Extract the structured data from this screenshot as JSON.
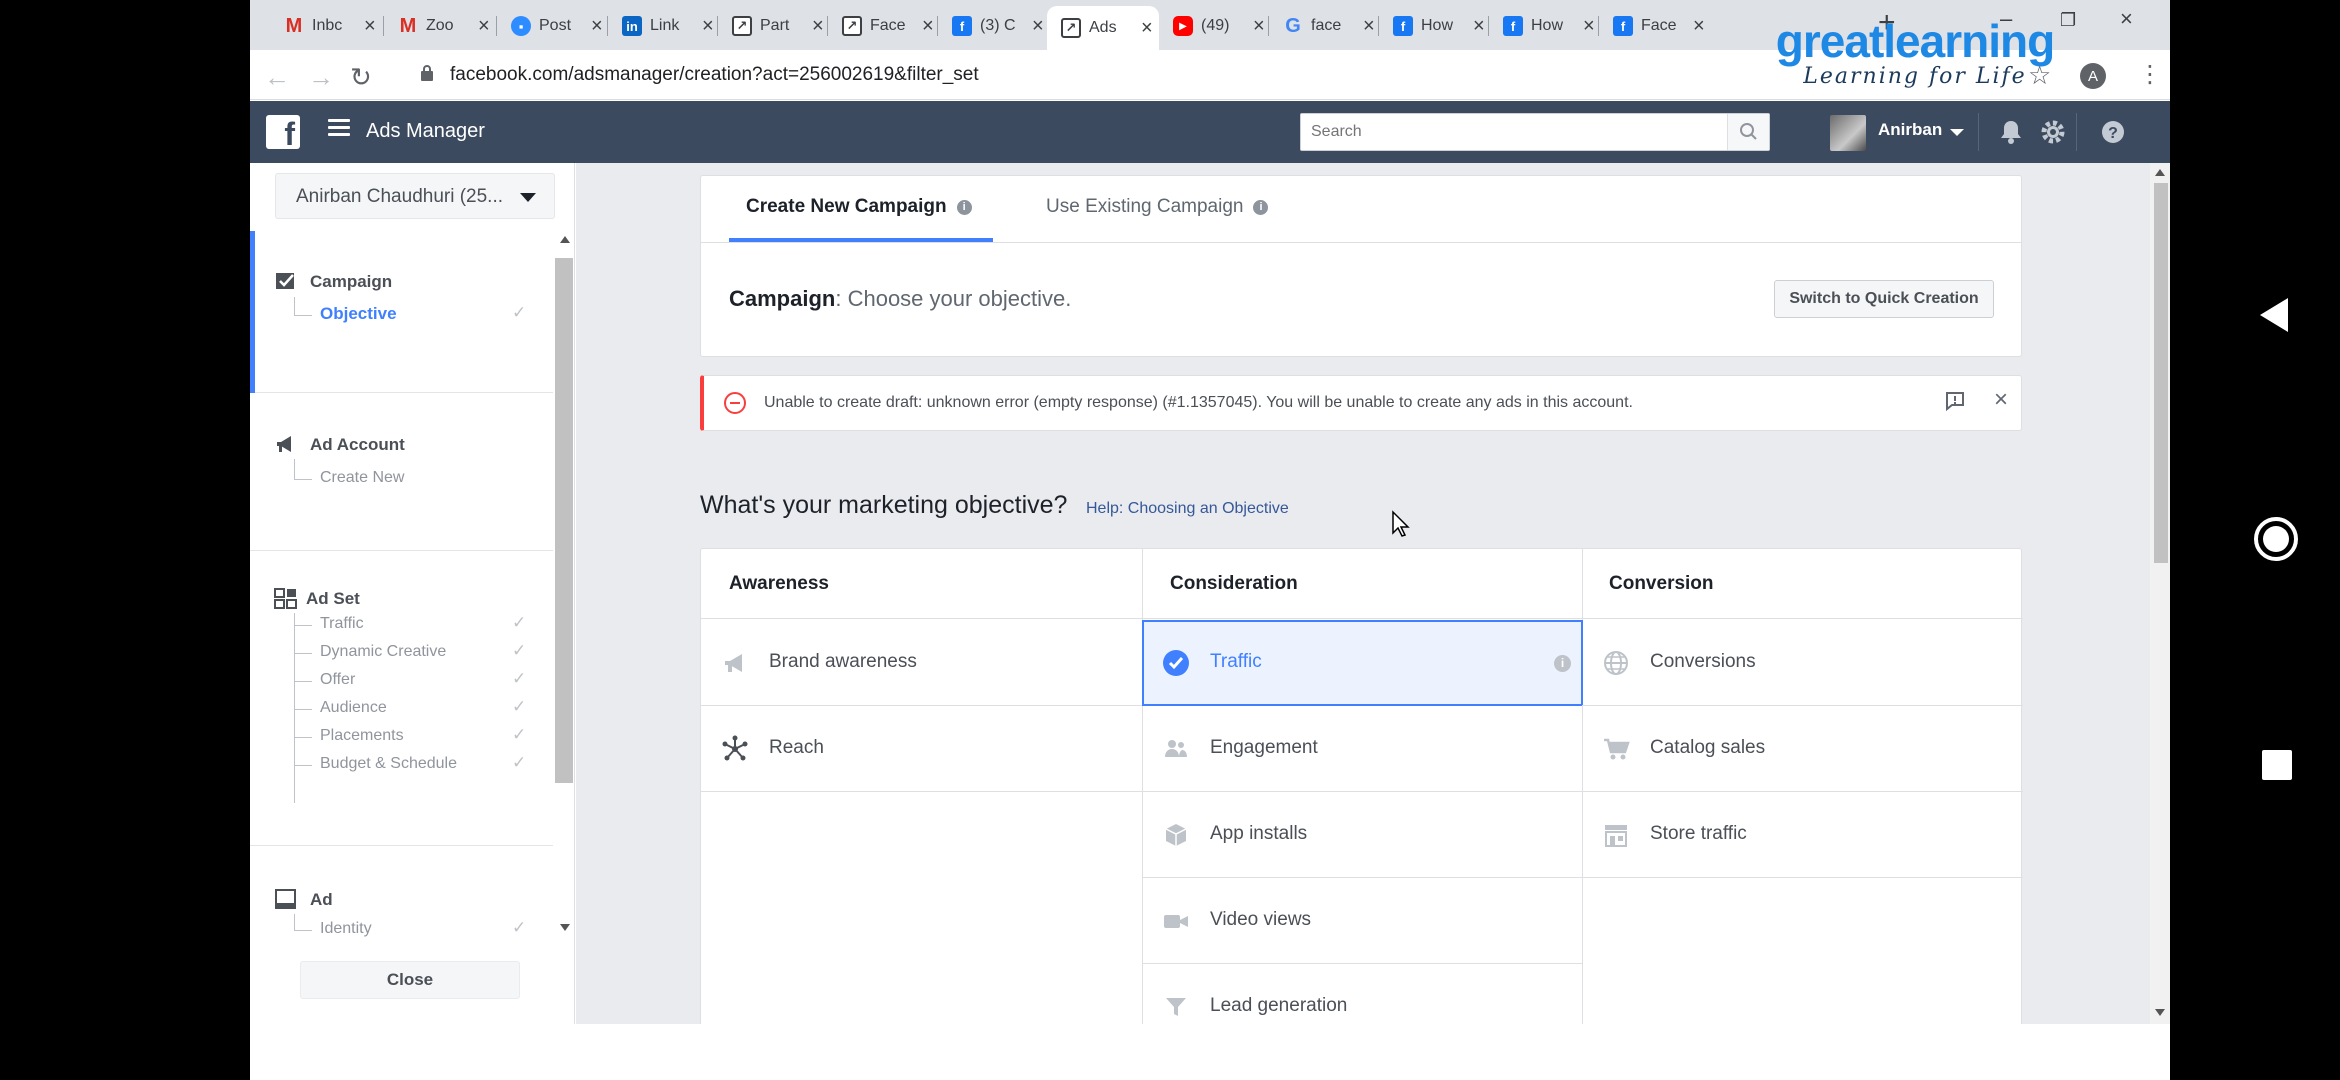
{
  "browser": {
    "tabs": [
      {
        "label": "Inbc",
        "icon": "gmail-icon"
      },
      {
        "label": "Zoo",
        "icon": "gmail-icon"
      },
      {
        "label": "Post",
        "icon": "zoom-icon"
      },
      {
        "label": "Link",
        "icon": "linkedin-icon"
      },
      {
        "label": "Part",
        "icon": "ads-manager-icon"
      },
      {
        "label": "Face",
        "icon": "ads-manager-icon"
      },
      {
        "label": "(3) C",
        "icon": "facebook-icon"
      },
      {
        "label": "Ads",
        "icon": "ads-manager-icon",
        "active": true
      },
      {
        "label": "(49)",
        "icon": "youtube-icon"
      },
      {
        "label": "face",
        "icon": "google-icon"
      },
      {
        "label": "How",
        "icon": "facebook-icon"
      },
      {
        "label": "How",
        "icon": "facebook-icon"
      },
      {
        "label": "Face",
        "icon": "facebook-icon"
      }
    ],
    "new_tab": "+",
    "close_glyph": "×",
    "url": "facebook.com/adsmanager/creation?act=256002619&filter_set",
    "profile_initial": "A"
  },
  "watermark": {
    "logo": "greatlearning",
    "tagline": "Learning for Life"
  },
  "header": {
    "app_title": "Ads Manager",
    "search_placeholder": "Search",
    "user_name": "Anirban"
  },
  "sidebar": {
    "account": "Anirban Chaudhuri (25...",
    "sections": {
      "campaign": {
        "title": "Campaign",
        "items": [
          "Objective"
        ]
      },
      "ad_account": {
        "title": "Ad Account",
        "items": [
          "Create New"
        ]
      },
      "ad_set": {
        "title": "Ad Set",
        "items": [
          "Traffic",
          "Dynamic Creative",
          "Offer",
          "Audience",
          "Placements",
          "Budget & Schedule"
        ]
      },
      "ad": {
        "title": "Ad",
        "items": [
          "Identity"
        ]
      }
    },
    "check": "✓",
    "close_label": "Close"
  },
  "main": {
    "tabs": {
      "create": "Create New Campaign",
      "existing": "Use Existing Campaign"
    },
    "info_glyph": "i",
    "campaign_label": "Campaign",
    "campaign_text": ": Choose your objective.",
    "quick_creation": "Switch to Quick Creation",
    "error_text": "Unable to create draft: unknown error (empty response) (#1.1357045). You will be unable to create any ads in this account.",
    "question": "What's your marketing objective?",
    "help_link": "Help: Choosing an Objective",
    "columns": {
      "awareness": {
        "title": "Awareness",
        "items": [
          "Brand awareness",
          "Reach"
        ]
      },
      "consideration": {
        "title": "Consideration",
        "items": [
          "Traffic",
          "Engagement",
          "App installs",
          "Video views",
          "Lead generation"
        ]
      },
      "conversion": {
        "title": "Conversion",
        "items": [
          "Conversions",
          "Catalog sales",
          "Store traffic"
        ]
      }
    },
    "selected": "Traffic"
  },
  "colors": {
    "accent": "#4080ff",
    "header_bg": "#3b4a5f",
    "error": "#fa3e3e"
  }
}
